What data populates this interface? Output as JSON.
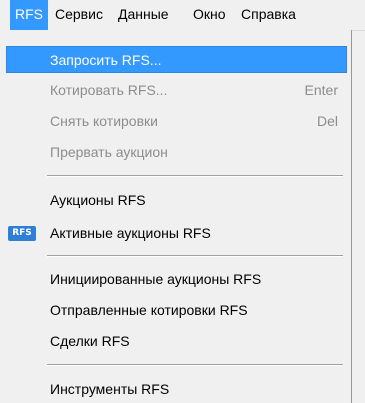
{
  "menubar": {
    "items": [
      {
        "label": "RFS"
      },
      {
        "label": "Сервис"
      },
      {
        "label": "Данные"
      },
      {
        "label": "Окно"
      },
      {
        "label": "Справка"
      }
    ]
  },
  "menu": {
    "items": [
      {
        "label": "Запросить RFS...",
        "shortcut": ""
      },
      {
        "label": "Котировать RFS...",
        "shortcut": "Enter"
      },
      {
        "label": "Снять котировки",
        "shortcut": "Del"
      },
      {
        "label": "Прервать аукцион",
        "shortcut": ""
      },
      {
        "label": "Аукционы RFS",
        "shortcut": ""
      },
      {
        "label": "Активные аукционы RFS",
        "shortcut": "",
        "icon_text": "RFS",
        "icon": "rfs-icon"
      },
      {
        "label": "Инициированные аукционы RFS",
        "shortcut": ""
      },
      {
        "label": "Отправленные котировки RFS",
        "shortcut": ""
      },
      {
        "label": "Сделки RFS",
        "shortcut": ""
      },
      {
        "label": "Инструменты RFS",
        "shortcut": ""
      }
    ]
  },
  "colors": {
    "highlight": "#3399ff",
    "disabled_text": "#8d8d8d",
    "background": "#f0f0f0"
  }
}
